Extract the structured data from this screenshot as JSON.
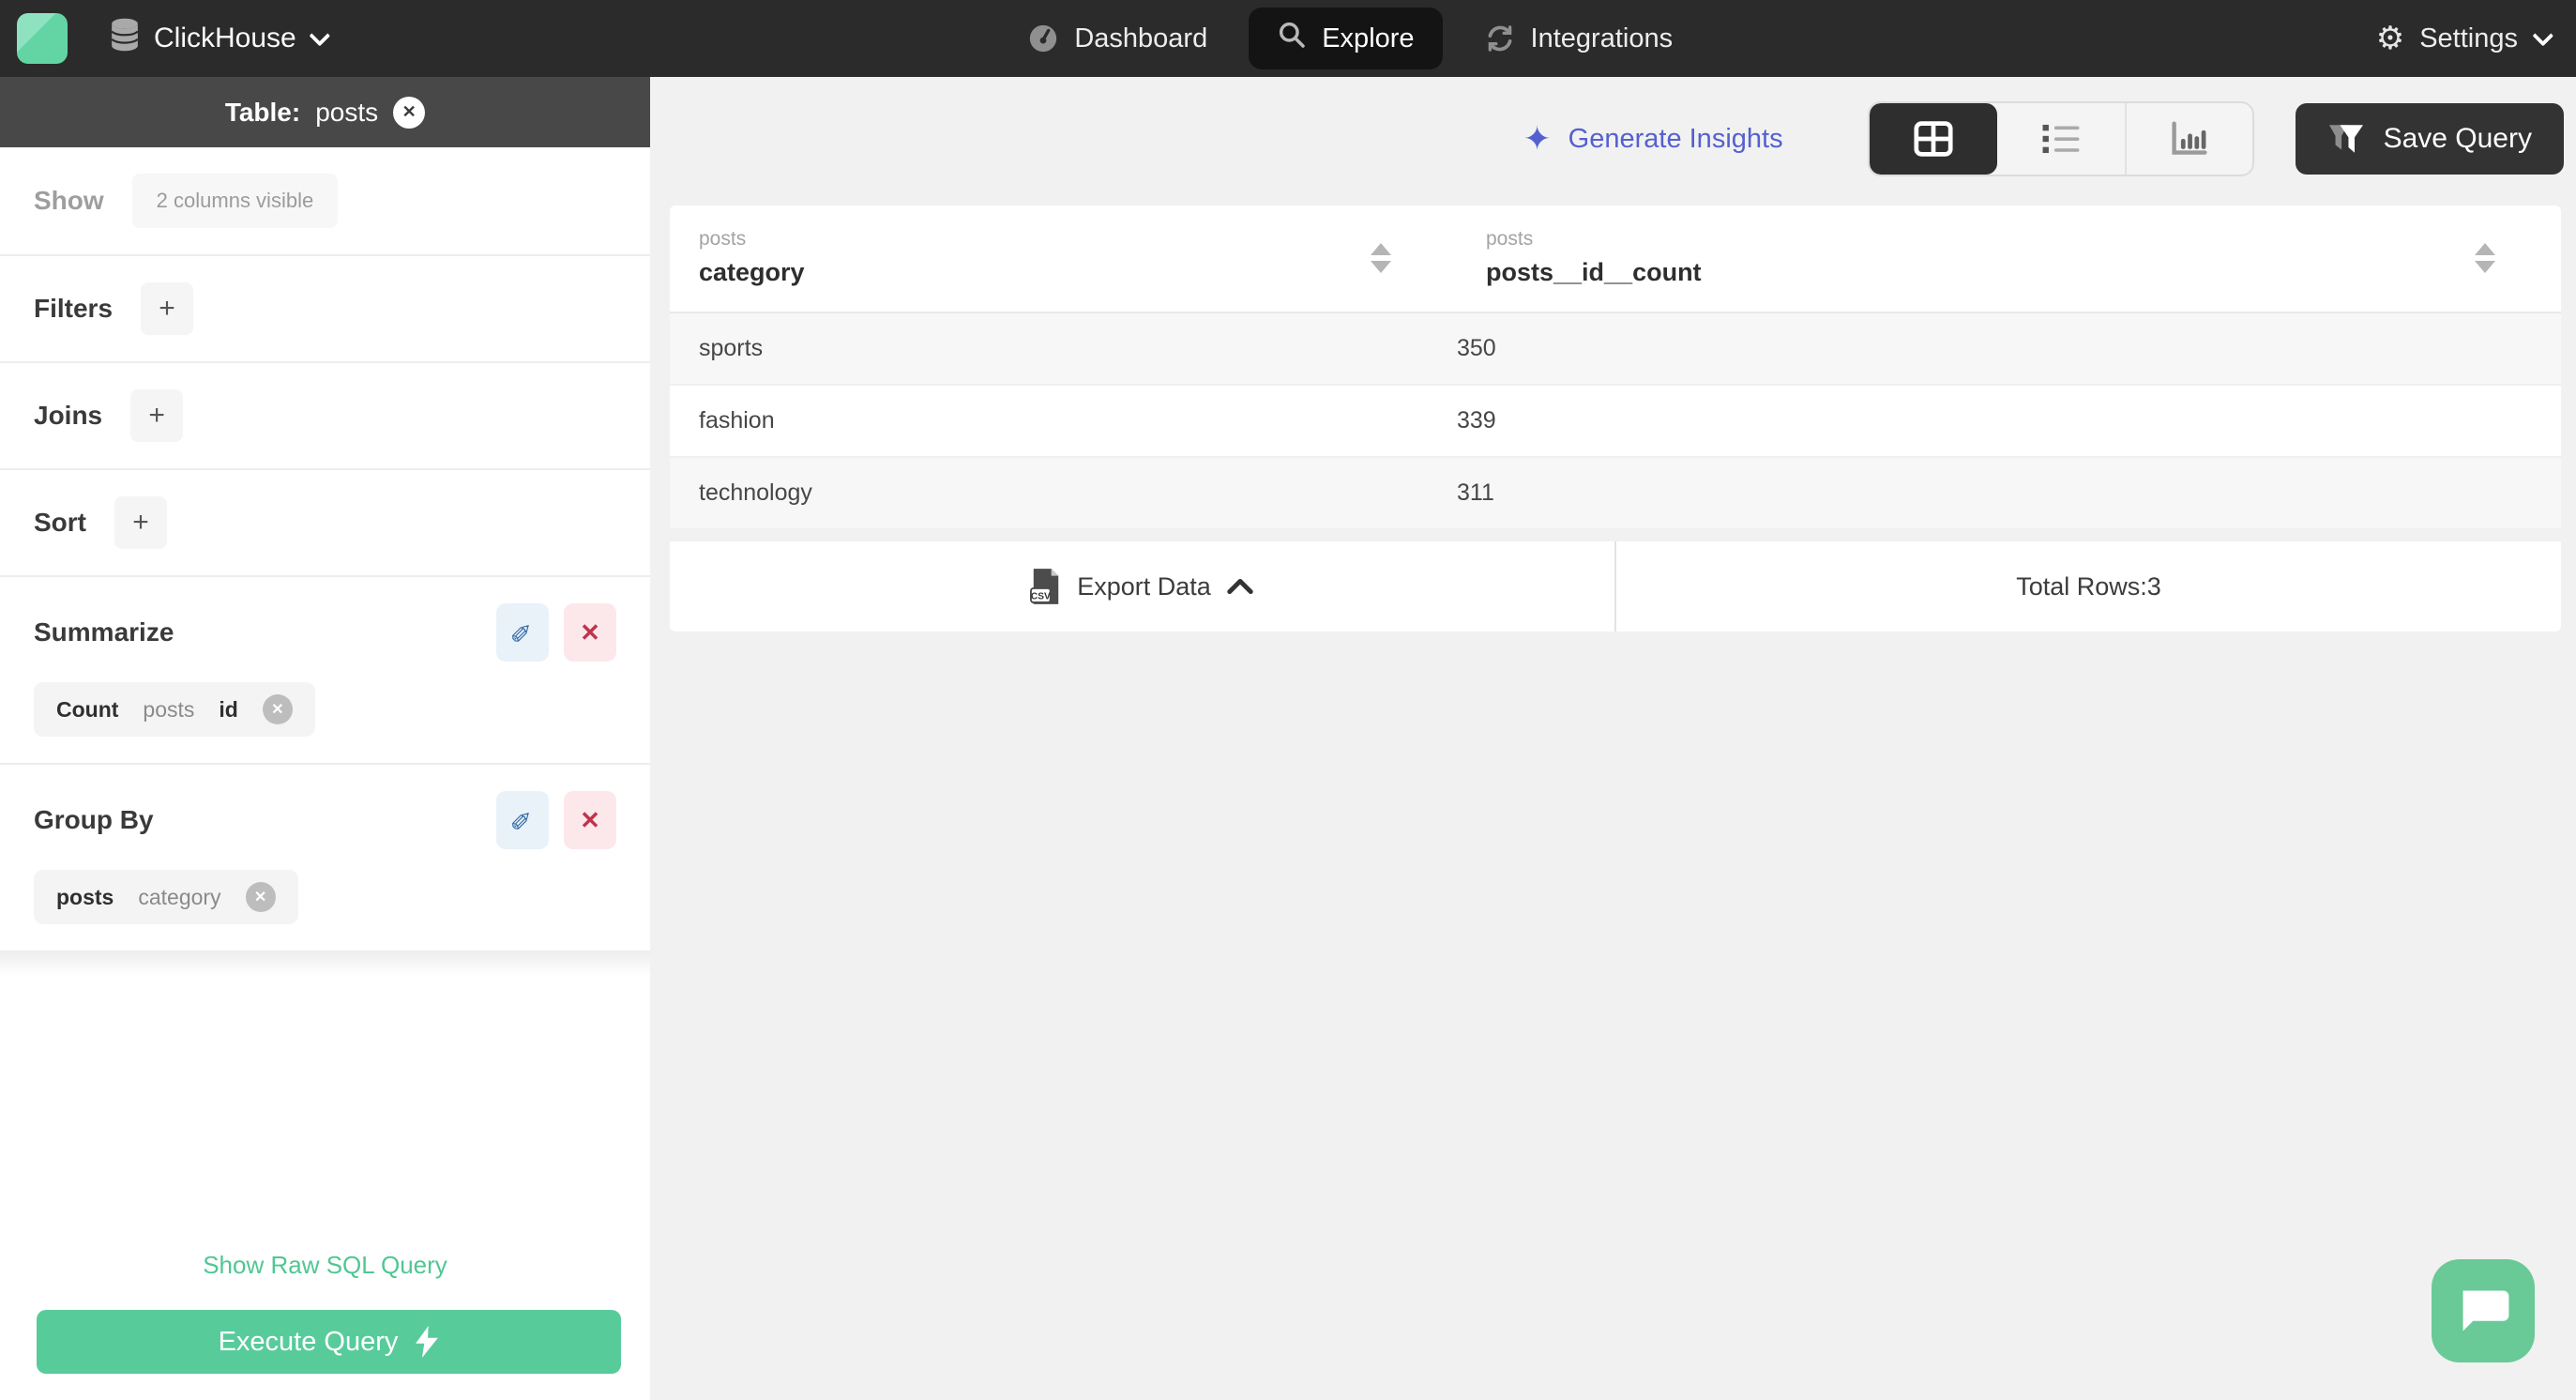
{
  "topbar": {
    "brand_name": "ClickHouse",
    "nav": [
      {
        "label": "Dashboard"
      },
      {
        "label": "Explore"
      },
      {
        "label": "Integrations"
      }
    ],
    "settings_label": "Settings"
  },
  "sidebar": {
    "header": {
      "prefix": "Table:",
      "table_name": "posts"
    },
    "show": {
      "label": "Show",
      "summary": "2 columns visible"
    },
    "filters": {
      "label": "Filters",
      "add": "+"
    },
    "joins": {
      "label": "Joins",
      "add": "+"
    },
    "sort": {
      "label": "Sort",
      "add": "+"
    },
    "summarize": {
      "label": "Summarize",
      "chip": {
        "fn": "Count",
        "table": "posts",
        "column": "id"
      }
    },
    "group_by": {
      "label": "Group By",
      "chip": {
        "table": "posts",
        "column": "category"
      }
    },
    "raw_sql_link": "Show Raw SQL Query",
    "execute_button": "Execute Query"
  },
  "main": {
    "insights_link": "Generate Insights",
    "save_button": "Save Query",
    "table": {
      "columns": [
        {
          "group": "posts",
          "name": "category"
        },
        {
          "group": "posts",
          "name": "posts__id__count"
        }
      ],
      "rows": [
        {
          "category": "sports",
          "count": "350"
        },
        {
          "category": "fashion",
          "count": "339"
        },
        {
          "category": "technology",
          "count": "311"
        }
      ],
      "export_label": "Export Data",
      "total_rows_label": "Total Rows:3"
    }
  },
  "colors": {
    "accent_green": "#58cb9b",
    "link_green": "#4fc793",
    "accent_indigo": "#5560d0",
    "topbar_dark": "#2b2b2b"
  }
}
